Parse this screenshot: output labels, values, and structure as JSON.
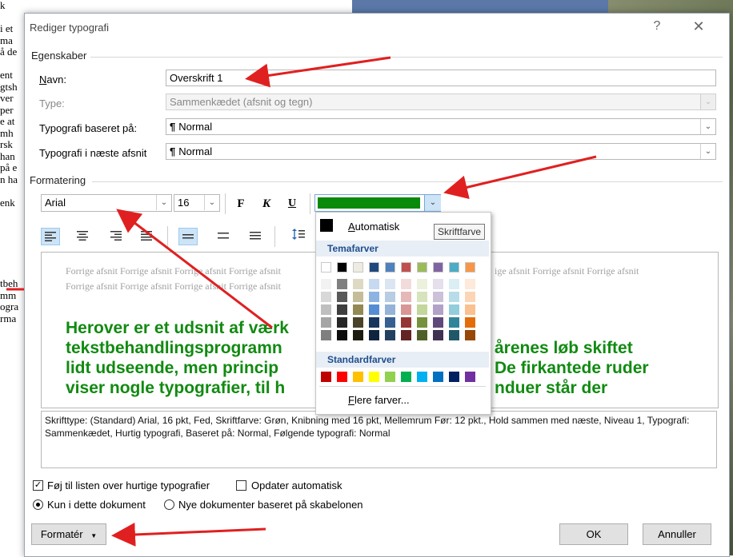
{
  "background_doc": {
    "lines": [
      "k",
      "",
      "i et",
      "ma",
      "å de",
      "",
      "ent",
      "gtsh",
      "ver",
      "per",
      "e at",
      "mh",
      "rsk",
      "han",
      "på e",
      "n ha",
      "",
      "enk",
      "",
      "",
      "",
      "",
      "",
      "",
      "tbeh",
      "mm",
      "ogra",
      "rma"
    ]
  },
  "dialog": {
    "title": "Rediger typografi",
    "help_label": "?",
    "close_label": "✕",
    "properties": {
      "group_label": "Egenskaber",
      "name_label": "Navn:",
      "name_value": "Overskrift 1",
      "type_label": "Type:",
      "type_value": "Sammenkædet (afsnit og tegn)",
      "based_on_label": "Typografi baseret på:",
      "based_on_value": "Normal",
      "next_label": "Typografi i næste afsnit",
      "next_value": "Normal"
    },
    "formatting": {
      "group_label": "Formatering",
      "font": "Arial",
      "size": "16",
      "bold_label": "F",
      "italic_label": "K",
      "underline_label": "U",
      "font_color_hex": "#0a8a0a"
    },
    "preview": {
      "grey_line1a": "Forrige afsnit Forrige afsnit Forrige afsnit Forrige afsnit",
      "grey_line1b": "ige afsnit Forrige afsnit Forrige afsnit",
      "grey_line2": "Forrige afsnit Forrige afsnit Forrige afsnit Forrige afsnit",
      "green_lines": [
        [
          "Herover er et udsnit af værk",
          ""
        ],
        [
          "tekstbehandlingsprogramn",
          "årenes løb skiftet"
        ],
        [
          "lidt udseende, men princip",
          "De firkantede ruder"
        ],
        [
          "viser nogle typografier, til h",
          "nduer står der"
        ]
      ]
    },
    "description": "Skrifttype: (Standard) Arial, 16 pkt, Fed, Skriftfarve: Grøn, Knibning med 16 pkt, Mellemrum Før:  12 pkt., Hold sammen med næste, Niveau 1, Typografi: Sammenkædet, Hurtig typografi, Baseret på: Normal, Følgende typografi: Normal",
    "options": {
      "quick_list_label": "Føj til listen over hurtige typografier",
      "quick_list_checked": true,
      "auto_update_label": "Opdater automatisk",
      "auto_update_checked": false,
      "this_doc_label": "Kun i dette dokument",
      "template_label": "Nye dokumenter baseret på skabelonen"
    },
    "buttons": {
      "format_label": "Formatér",
      "ok_label": "OK",
      "cancel_label": "Annuller"
    }
  },
  "color_popup": {
    "automatic_label": "Automatisk",
    "theme_label": "Temafarver",
    "standard_label": "Standardfarver",
    "more_label": "Flere farver...",
    "tooltip": "Skriftfarve",
    "theme_top": [
      "#ffffff",
      "#000000",
      "#e7e6e6",
      "#44546a",
      "#4472c4",
      "#ed7d31",
      "#a5a5a5",
      "#ffc000",
      "#5b9bd5",
      "#70ad47"
    ],
    "theme_top_display": [
      "#ffffff",
      "#000000",
      "#eeece1",
      "#1f497d",
      "#4f81bd",
      "#c0504d",
      "#9bbb59",
      "#8064a2",
      "#4bacc6",
      "#f79646"
    ],
    "theme_shades": [
      [
        "#f2f2f2",
        "#7f7f7f",
        "#ddd9c3",
        "#c6d9f0",
        "#dbe5f1",
        "#f2dcdb",
        "#ebf1dd",
        "#e5e0ec",
        "#dbeef3",
        "#fdeada"
      ],
      [
        "#d8d8d8",
        "#595959",
        "#c4bd97",
        "#8db3e2",
        "#b8cce4",
        "#e5b9b7",
        "#d7e3bc",
        "#ccc1d9",
        "#b7dde8",
        "#fbd5b5"
      ],
      [
        "#bfbfbf",
        "#3f3f3f",
        "#938953",
        "#548dd4",
        "#95b3d7",
        "#d99694",
        "#c3d69b",
        "#b2a2c7",
        "#92cddc",
        "#fac08f"
      ],
      [
        "#a5a5a5",
        "#262626",
        "#494429",
        "#17365d",
        "#366092",
        "#953734",
        "#76923c",
        "#5f497a",
        "#31859b",
        "#e36c09"
      ],
      [
        "#7f7f7f",
        "#0c0c0c",
        "#1d1b10",
        "#0f243e",
        "#244061",
        "#632423",
        "#4f6128",
        "#3f3151",
        "#205867",
        "#974806"
      ]
    ],
    "standard": [
      "#c00000",
      "#ff0000",
      "#ffc000",
      "#ffff00",
      "#92d050",
      "#00b050",
      "#00b0f0",
      "#0070c0",
      "#002060",
      "#7030a0"
    ]
  },
  "annotation_color": "#e02020"
}
